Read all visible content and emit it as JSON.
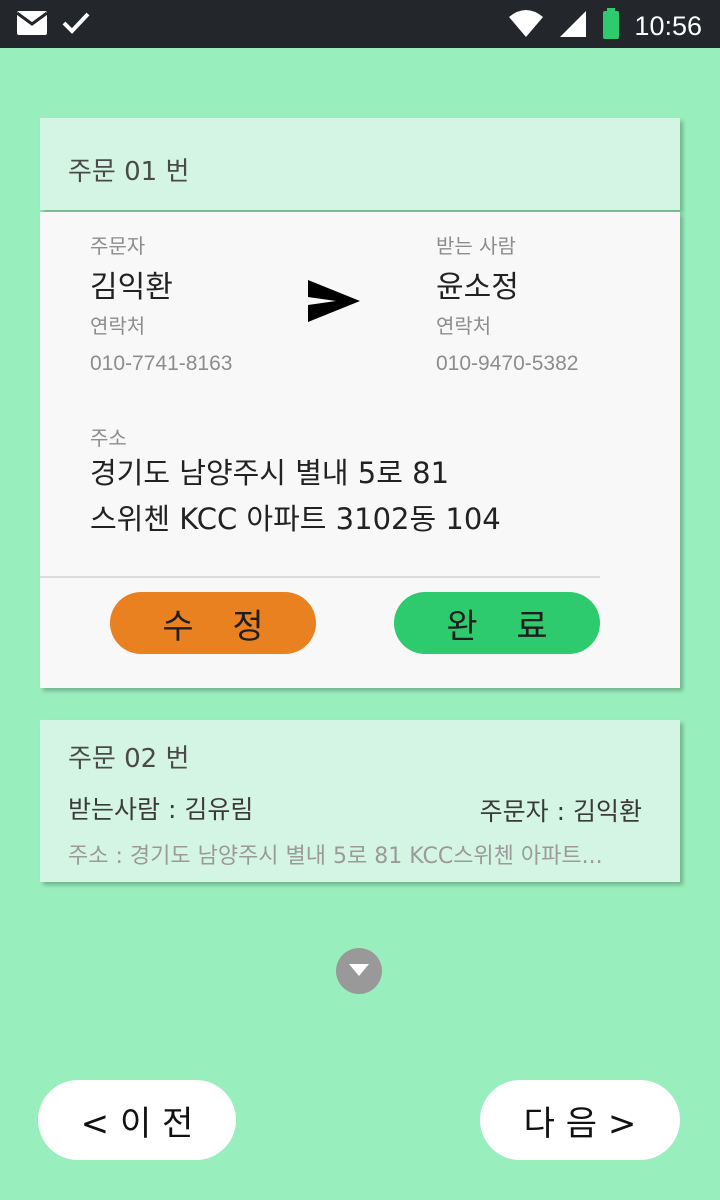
{
  "status_bar": {
    "time": "10:56",
    "left_icons": [
      "mail-icon",
      "check-icon"
    ],
    "right_icons": [
      "wifi-icon",
      "signal-icon",
      "battery-icon"
    ],
    "battery_color": "#2ecb6e"
  },
  "order1": {
    "title": "주문 01 번",
    "orderer_label": "주문자",
    "orderer_name": "김익환",
    "orderer_contact_label": "연락처",
    "orderer_phone": "010-7741-8163",
    "receiver_label": "받는 사람",
    "receiver_name": "윤소정",
    "receiver_contact_label": "연락처",
    "receiver_phone": "010-9470-5382",
    "address_label": "주소",
    "address_line1": "경기도 남양주시 별내 5로 81",
    "address_line2": "스위첸 KCC 아파트 3102동 104",
    "edit_button": "수 정",
    "done_button": "완 료",
    "edit_color": "#e98120",
    "done_color": "#2ecb6e"
  },
  "order2": {
    "title": "주문 02 번",
    "receiver": "받는사람 :  김유림",
    "orderer": "주문자 : 김익환",
    "address": "주소 : 경기도 남양주시 별내 5로 81 KCC스위첸 아파트..."
  },
  "nav": {
    "prev": "< 이 전",
    "next": "다 음 >"
  },
  "colors": {
    "background": "#98efbd",
    "card_header": "#d5f5e4",
    "status_bar": "#23262b"
  }
}
